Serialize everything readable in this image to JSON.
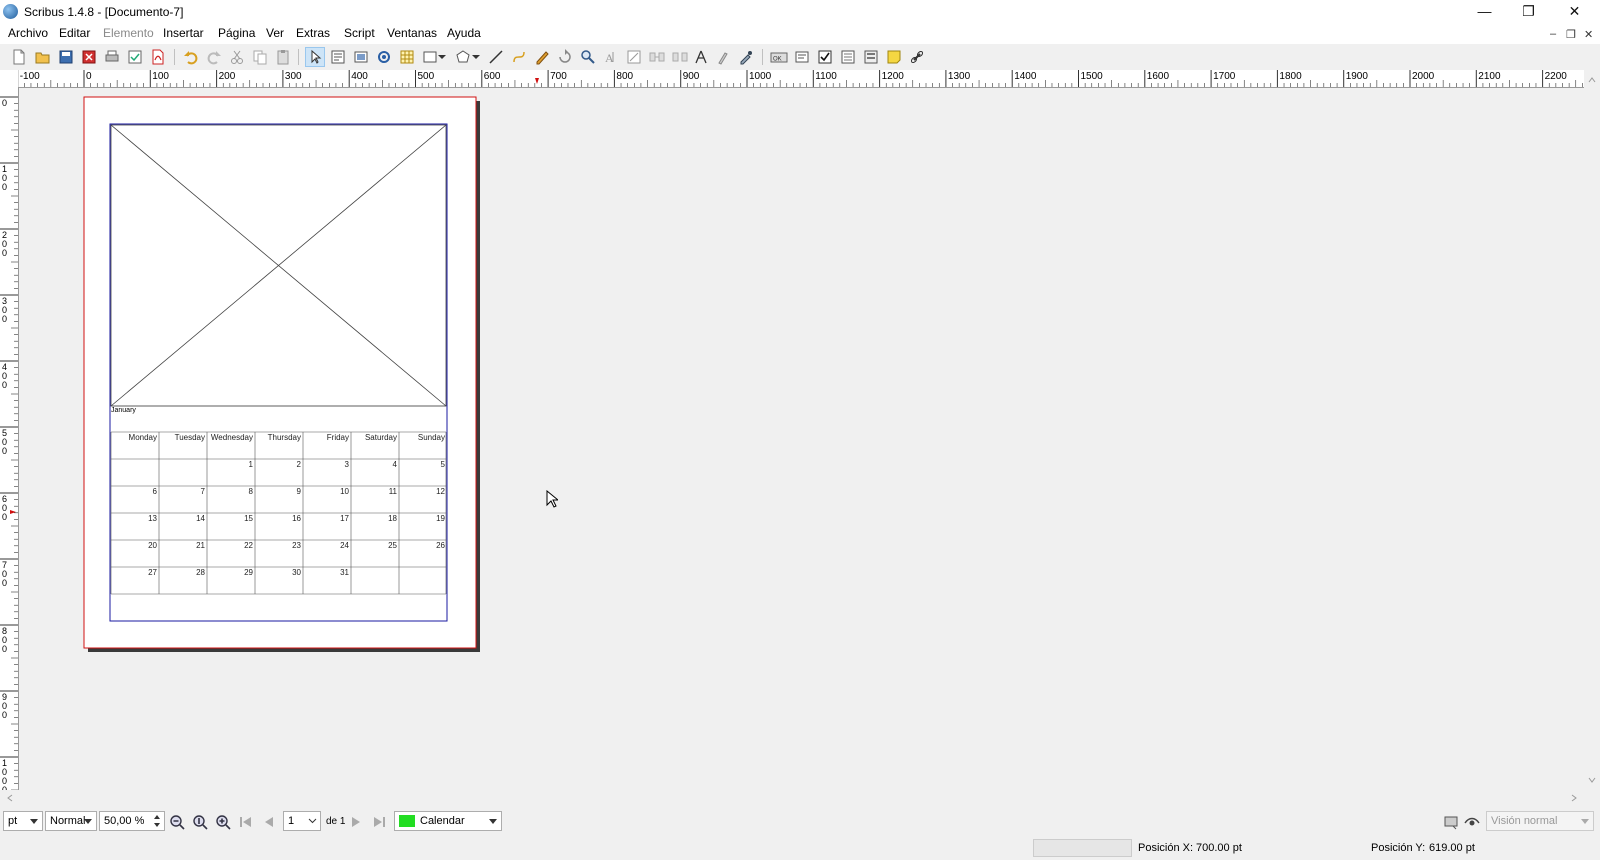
{
  "window": {
    "title": "Scribus 1.4.8 - [Documento-7]",
    "minimize": "—",
    "maximize": "❐",
    "close": "✕"
  },
  "menu": [
    {
      "label": "Archivo",
      "enabled": true
    },
    {
      "label": "Editar",
      "enabled": true
    },
    {
      "label": "Elemento",
      "enabled": false
    },
    {
      "label": "Insertar",
      "enabled": true
    },
    {
      "label": "Página",
      "enabled": true
    },
    {
      "label": "Ver",
      "enabled": true
    },
    {
      "label": "Extras",
      "enabled": true
    },
    {
      "label": "Script",
      "enabled": true
    },
    {
      "label": "Ventanas",
      "enabled": true
    },
    {
      "label": "Ayuda",
      "enabled": true
    }
  ],
  "toolbar_icons": [
    "new-document-icon",
    "open-icon",
    "save-icon",
    "close-document-icon",
    "print-icon",
    "preflight-icon",
    "export-pdf-icon",
    "undo-icon",
    "redo-icon",
    "cut-icon",
    "copy-icon",
    "paste-icon",
    "select-icon",
    "text-frame-icon",
    "image-frame-icon",
    "render-frame-icon",
    "table-icon",
    "shape-icon",
    "polygon-icon",
    "line-icon",
    "bezier-icon",
    "freehand-icon",
    "rotate-icon",
    "zoom-icon",
    "edit-text-icon",
    "story-editor-icon",
    "link-frames-icon",
    "unlink-frames-icon",
    "measure-icon",
    "copy-properties-icon",
    "eyedropper-icon",
    "pdf-button-icon",
    "pdf-text-field-icon",
    "pdf-checkbox-icon",
    "pdf-combo-box-icon",
    "pdf-list-box-icon",
    "pdf-annotation-icon",
    "pdf-link-icon"
  ],
  "rulers": {
    "horizontal_labels": [
      "-100",
      "0",
      "100",
      "200",
      "300",
      "400",
      "500",
      "600",
      "700",
      "800",
      "900",
      "1000",
      "1100",
      "1200",
      "1300",
      "1400",
      "1500",
      "1600",
      "1700",
      "1800",
      "1900",
      "2000",
      "2100",
      "2200"
    ],
    "vertical_labels": [
      "0",
      "100",
      "200",
      "300",
      "400",
      "500",
      "600",
      "700",
      "800",
      "900",
      "1000"
    ]
  },
  "calendar": {
    "month": "January",
    "weekdays": [
      "Monday",
      "Tuesday",
      "Wednesday",
      "Thursday",
      "Friday",
      "Saturday",
      "Sunday"
    ],
    "weeks": [
      [
        "",
        "",
        "1",
        "2",
        "3",
        "4",
        "5"
      ],
      [
        "6",
        "7",
        "8",
        "9",
        "10",
        "11",
        "12"
      ],
      [
        "13",
        "14",
        "15",
        "16",
        "17",
        "18",
        "19"
      ],
      [
        "20",
        "21",
        "22",
        "23",
        "24",
        "25",
        "26"
      ],
      [
        "27",
        "28",
        "29",
        "30",
        "31",
        "",
        ""
      ]
    ]
  },
  "bottom": {
    "unit": "pt",
    "mode": "Normal",
    "zoom": "50,00 %",
    "page": "1",
    "of_pages": "de 1",
    "layer": "Calendar",
    "layer_color": "#22dd22",
    "view_mode": "Visión normal"
  },
  "status": {
    "pos_x_label": "Posición X:",
    "pos_x_value": "700.00 pt",
    "pos_y_label": "Posición Y:",
    "pos_y_value": "619.00 pt"
  }
}
